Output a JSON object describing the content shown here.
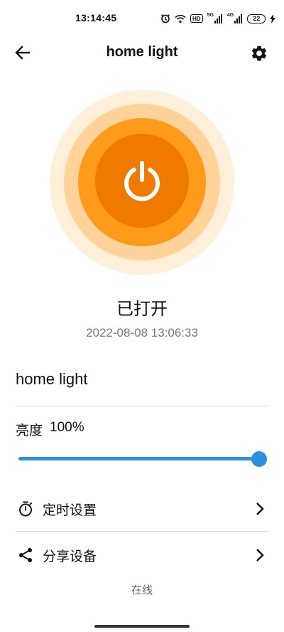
{
  "status_bar": {
    "time": "13:14:45",
    "network_label_1": "HD",
    "network_label_2": "5G",
    "network_label_3": "4G",
    "battery": "22"
  },
  "header": {
    "title": "home light"
  },
  "power": {
    "state_text": "已打开",
    "timestamp": "2022-08-08 13:06:33",
    "accent_color": "#F07A00"
  },
  "device": {
    "name": "home light"
  },
  "brightness": {
    "label": "亮度",
    "value_text": "100%",
    "value": 1.0,
    "color": "#2D8FE0"
  },
  "rows": [
    {
      "label": "定时设置",
      "icon": "timer-icon"
    },
    {
      "label": "分享设备",
      "icon": "share-icon"
    }
  ],
  "footer": {
    "status": "在线"
  }
}
